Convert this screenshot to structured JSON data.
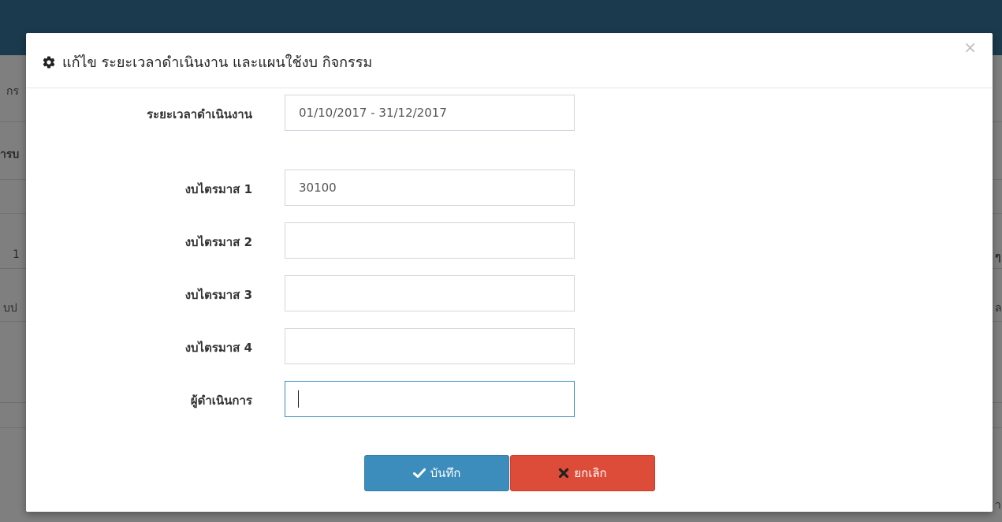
{
  "background": {
    "fragments": [
      "กร",
      "ารบ",
      "1",
      "บป",
      "ๆ",
      "ล",
      "า"
    ]
  },
  "modal": {
    "title": "แก้ไข ระยะเวลาดำเนินงาน และแผนใช้งบ กิจกรรม",
    "close_symbol": "×",
    "fields": [
      {
        "label": "ระยะเวลาดำเนินงาน",
        "value": "01/10/2017 - 31/12/2017",
        "placeholder": ""
      },
      {
        "label": "งบไตรมาส 1",
        "value": "30100",
        "placeholder": ""
      },
      {
        "label": "งบไตรมาส 2",
        "value": "",
        "placeholder": ""
      },
      {
        "label": "งบไตรมาส 3",
        "value": "",
        "placeholder": ""
      },
      {
        "label": "งบไตรมาส 4",
        "value": "",
        "placeholder": ""
      },
      {
        "label": "ผู้ดำเนินการ",
        "value": "",
        "placeholder": ""
      }
    ],
    "buttons": {
      "save_label": "บันทึก",
      "cancel_label": "ยกเลิก"
    }
  },
  "colors": {
    "topbar": "#1b3a4d",
    "save": "#3c8dbc",
    "cancel": "#dd4b39"
  },
  "icons": {
    "title": "gear-icon",
    "save": "check-icon",
    "cancel": "times-icon"
  }
}
